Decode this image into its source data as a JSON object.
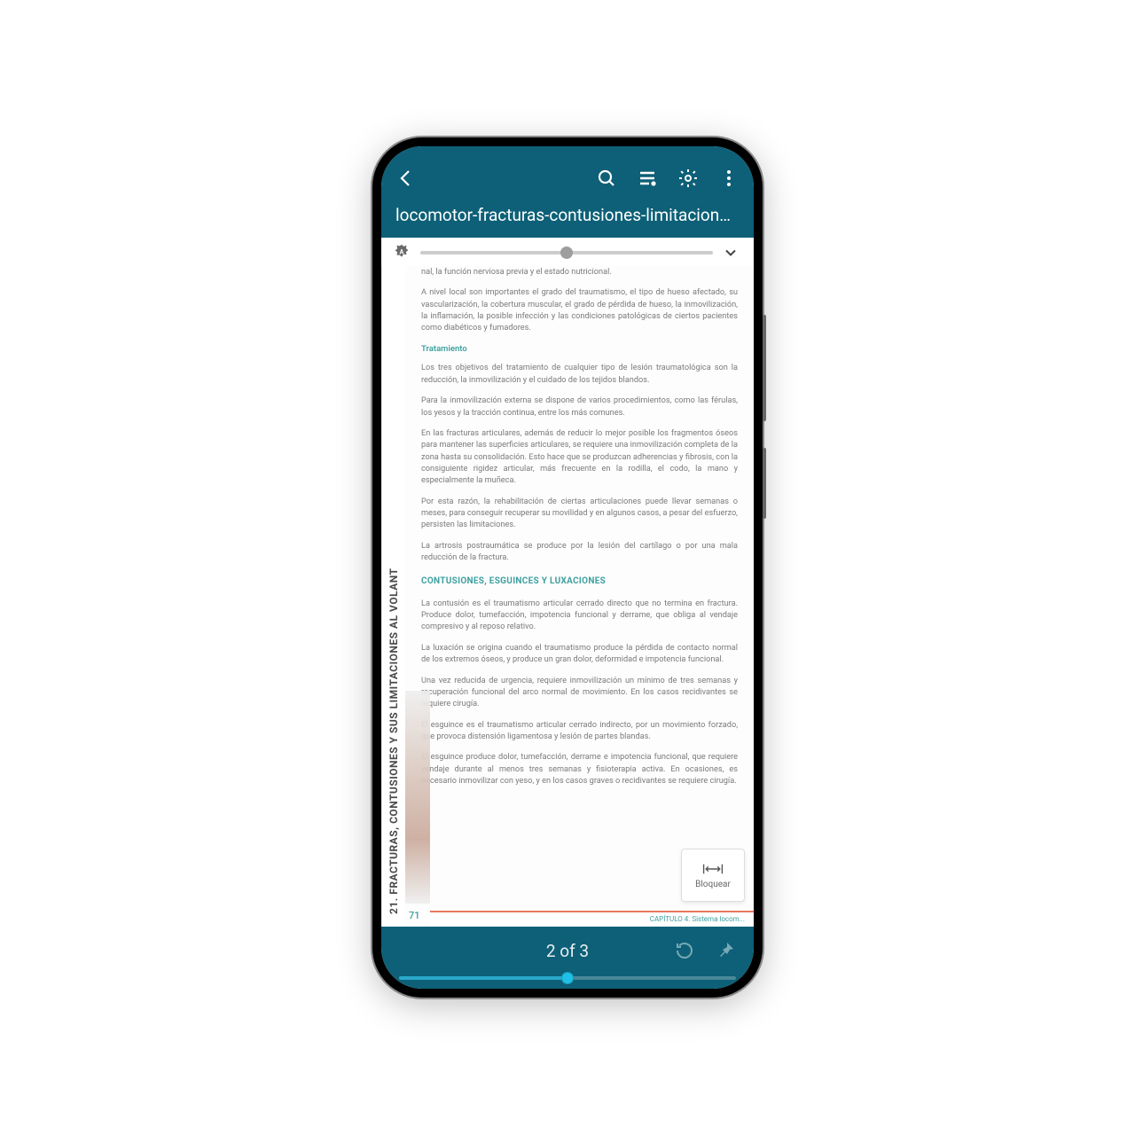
{
  "header": {
    "title": "locomotor-fracturas-contusiones-limitaciones..."
  },
  "document": {
    "side_title": "21. FRACTURAS, CONTUSIONES Y SUS LIMITACIONES AL VOLANT",
    "p_intro": "nal, la función nerviosa previa y el estado nutricional.",
    "p1": "A nivel local son importantes el grado del traumatismo, el tipo de hueso afectado, su vascularización, la cobertura muscular, el grado de pérdida de hueso, la inmovilización, la inflamación, la posible infección y las condiciones patológicas de ciertos pacientes como diabéticos y fumadores.",
    "h_trat": "Tratamiento",
    "p2": "Los tres objetivos del tratamiento de cualquier tipo de lesión traumatológica son la reducción, la inmovilización y el cuidado de los tejidos blandos.",
    "p3": "Para la inmovilización externa se dispone de varios procedimientos, como las férulas, los yesos y la tracción continua, entre los más comunes.",
    "p4": "En las fracturas articulares, además de reducir lo mejor posible los fragmentos óseos para mantener las superficies articulares, se requiere una inmovilización completa de la zona hasta su consolidación. Esto hace que se produzcan adherencias y fibrosis, con la consiguiente rigidez articular, más frecuente en la rodilla, el codo, la mano y especialmente la muñeca.",
    "p5": "Por esta razón, la rehabilitación de ciertas articulaciones puede llevar semanas o meses, para conseguir recuperar su movilidad y en algunos casos, a pesar del esfuerzo, persisten las limitaciones.",
    "p6": "La artrosis postraumática se produce por la lesión del cartílago o por una mala reducción de la fractura.",
    "h_cont": "CONTUSIONES, ESGUINCES Y LUXACIONES",
    "p7": "La contusión es el traumatismo articular cerrado directo que no termina en fractura. Produce dolor, tumefacción, impotencia funcional y derrame, que obliga al vendaje compresivo y al reposo relativo.",
    "p8": "La luxación se origina cuando el traumatismo produce la pérdida de contacto normal de los extremos óseos, y produce un gran dolor, deformidad e impotencia funcional.",
    "p9": "Una vez reducida de urgencia, requiere inmovilización un mínimo de tres semanas y recuperación funcional del arco normal de movimiento. En los casos recidivantes se requiere cirugía.",
    "p10": "El esguince es el traumatismo articular cerrado indirecto, por un movimiento forzado, que provoca distensión ligamentosa y lesión de partes blandas.",
    "p11": "El esguince produce dolor, tumefacción, derrame e impotencia funcional, que requiere vendaje durante al menos tres semanas y fisioterapia activa. En ocasiones, es necesario inmovilizar con yeso, y en los casos graves o recidivantes se requiere cirugía.",
    "page_number": "71",
    "chapter_footer": "CAPÍTULO 4. Sistema locom..."
  },
  "lock_button": {
    "label": "Bloquear"
  },
  "footer": {
    "counter": "2 of 3"
  }
}
